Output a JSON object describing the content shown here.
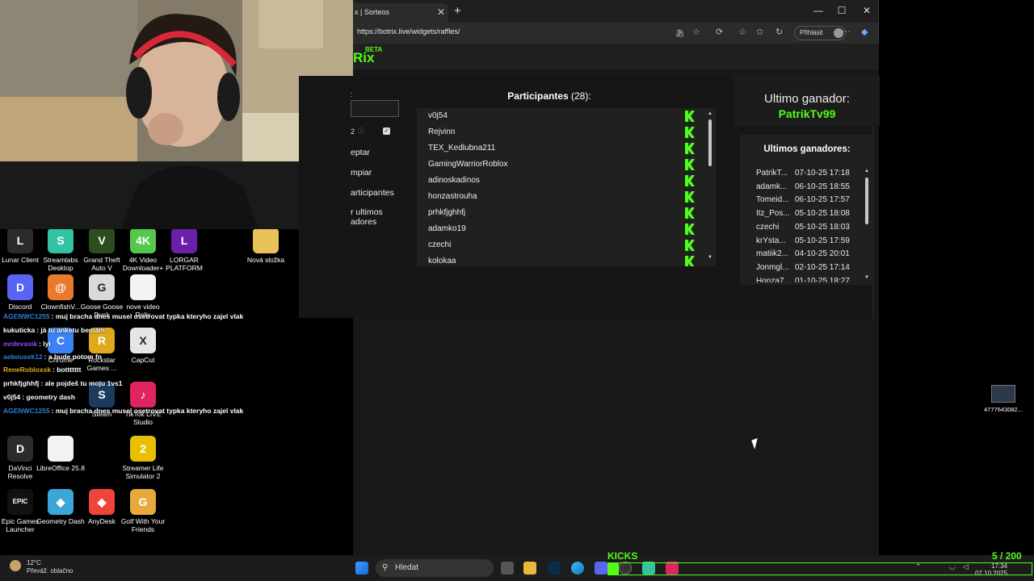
{
  "desktop": {
    "icons": [
      {
        "label": "Lunar Client",
        "glyph": "L",
        "color": "#2b2b2b"
      },
      {
        "label": "Streamlabs Desktop",
        "glyph": "S",
        "color": "#31c3a2"
      },
      {
        "label": "Grand Theft Auto V",
        "glyph": "V",
        "color": "#2d4d1f"
      },
      {
        "label": "4K Video Downloader+",
        "glyph": "4K",
        "color": "#53c84a"
      },
      {
        "label": "LORGAR PLATFORM",
        "glyph": "L",
        "color": "#6b1ea8"
      },
      {
        "label": "Nová složka",
        "glyph": "",
        "color": "#e8c35a"
      },
      {
        "label": "Discord",
        "glyph": "D",
        "color": "#5865f2"
      },
      {
        "label": "ClownfishV...",
        "glyph": "@",
        "color": "#e87a2c"
      },
      {
        "label": "Goose Goose Duck",
        "glyph": "G",
        "color": "#d9d9d9"
      },
      {
        "label": "nove video Relix",
        "glyph": "",
        "color": "#f2f2f2"
      },
      {
        "label": "Chrome",
        "glyph": "C",
        "color": "#3b82f6"
      },
      {
        "label": "Rockstar Games ...",
        "glyph": "R",
        "color": "#e0a81c"
      },
      {
        "label": "CapCut",
        "glyph": "X",
        "color": "#e6e6e6"
      },
      {
        "label": "Steam",
        "glyph": "S",
        "color": "#1b3b5f"
      },
      {
        "label": "TikTok LIVE Studio",
        "glyph": "♪",
        "color": "#e0245e"
      },
      {
        "label": "DaVinci Resolve",
        "glyph": "D",
        "color": "#2b2b2b"
      },
      {
        "label": "LibreOffice 25.8",
        "glyph": "",
        "color": "#f2f2f2"
      },
      {
        "label": "Streamer Life Simulator 2",
        "glyph": "2",
        "color": "#e8c000"
      },
      {
        "label": "Epic Games Launcher",
        "glyph": "EPIC",
        "color": "#111111"
      },
      {
        "label": "Geometry Dash",
        "glyph": "◆",
        "color": "#3da6d8"
      },
      {
        "label": "AnyDesk",
        "glyph": "◆",
        "color": "#ef443b"
      },
      {
        "label": "Golf With Your Friends",
        "glyph": "G",
        "color": "#e8a93c"
      }
    ],
    "right_icon_label": "4777643082..."
  },
  "chat": [
    {
      "user": "AGENWC1255",
      "msg": ": muj bracha dnes musel osetrovat typka kteryho zajel vlak",
      "color": "#2a7fd6"
    },
    {
      "user": "kukuticka",
      "msg": ": já tu anketu bemám",
      "color": "#ffffff"
    },
    {
      "user": "mrdevasik",
      "msg": ": lyl",
      "color": "#9146ff"
    },
    {
      "user": "aebousek12",
      "msg": ": a bude potom fn",
      "color": "#2a7fd6"
    },
    {
      "user": "ReneRobloxsk",
      "msg": ": bottttttt",
      "color": "#e0a81c"
    },
    {
      "user": "prhkfjghhfj",
      "msg": ": ale pojdeš tu moju 1vs1",
      "color": "#ffffff"
    },
    {
      "user": "v0j54",
      "msg": ": geometry dash",
      "color": "#ffffff"
    },
    {
      "user": "AGENWC1255",
      "msg": ": muj bracha dnes musel osetrovat typka kteryho zajel vlak",
      "color": "#2a7fd6"
    }
  ],
  "browser": {
    "tab_title": "x | Sorteos",
    "url": "https://botrix.live/widgets/raffles/",
    "signin_label": "Přihlásit",
    "brand": "Rix",
    "beta": "BETA"
  },
  "controls": {
    "colon_label": ":",
    "info_char": "2",
    "buttons": [
      "eptar",
      "mpiar",
      "articipantes",
      "r ultimos adores"
    ]
  },
  "participants": {
    "title": "Participantes",
    "count": "(28):",
    "names": [
      "v0j54",
      "Rejvinn",
      "TEX_Kedlubna211",
      "GamingWarriorRoblox",
      "adinoskadinos",
      "honzastrouha",
      "prhkfjghhfj",
      "adamko19",
      "czechi",
      "kolokaa"
    ]
  },
  "last_winner": {
    "title": "Ultimo ganador:",
    "name": "PatrikTv99"
  },
  "winners": {
    "title": "Ultimos ganadores:",
    "rows": [
      {
        "name": "PatrikT...",
        "date": "07-10-25 17:18"
      },
      {
        "name": "adamk...",
        "date": "06-10-25 18:55"
      },
      {
        "name": "Tomeid...",
        "date": "06-10-25 17:57"
      },
      {
        "name": "Itz_Pos...",
        "date": "05-10-25 18:08"
      },
      {
        "name": "czechi",
        "date": "05-10-25 18:03"
      },
      {
        "name": "krYsta...",
        "date": "05-10-25 17:59"
      },
      {
        "name": "matiik2...",
        "date": "04-10-25 20:01"
      },
      {
        "name": "Jonmgl...",
        "date": "02-10-25 17:14"
      },
      {
        "name": "Honza7...",
        "date": "01-10-25 18:27"
      }
    ]
  },
  "taskbar": {
    "temp": "12°C",
    "weather": "Převáž. oblačno",
    "search_placeholder": "Hledat",
    "time": "17:34",
    "date": "07.10.2025"
  },
  "kicks": {
    "label": "KICKS",
    "count": "5  / 200",
    "progress": 0.025
  },
  "colors": {
    "accent": "#53fc18",
    "bg": "#181818"
  }
}
